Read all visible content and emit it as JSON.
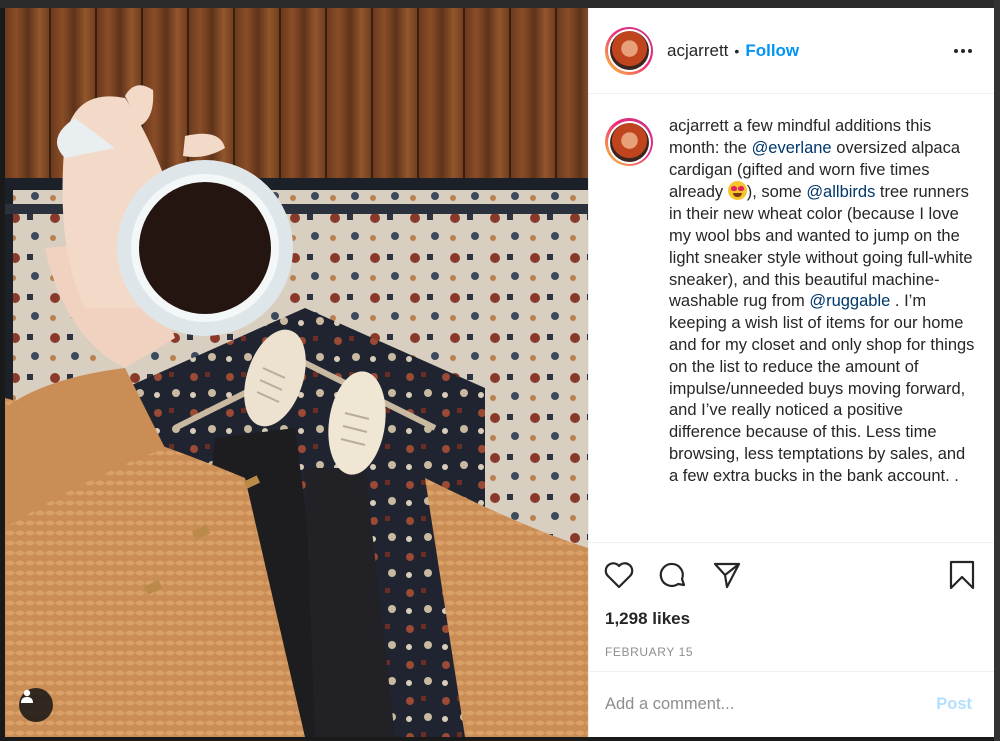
{
  "post": {
    "username": "acjarrett",
    "separator": "•",
    "follow_label": "Follow",
    "more_options_icon": "more-horizontal-icon",
    "caption": {
      "username": "acjarrett",
      "p1": " a few mindful additions this month: the ",
      "m1": "@everlane",
      "p2": " oversized alpaca cardigan (gifted and worn five times already ",
      "emoji": "heart-eyes-emoji",
      "p3": "), some ",
      "m2": "@allbirds",
      "p4": " tree runners in their new wheat color (because I love my wool bbs and wanted to jump on the light sneaker style without going full-white sneaker), and this beautiful machine-washable rug from ",
      "m3": "@ruggable",
      "p5": " . I’m keeping a wish list of items for our home and for my closet and only shop for things on the list to reduce the amount of impulse/unneeded buys moving forward, and I’ve really noticed a positive difference because of this. Less time browsing, less temptations by sales, and a few extra bucks in the bank account. ."
    },
    "actions": {
      "like_icon": "heart-icon",
      "comment_icon": "comment-icon",
      "share_icon": "paper-plane-icon",
      "save_icon": "bookmark-icon"
    },
    "likes": "1,298 likes",
    "date": "FEBRUARY 15",
    "comment": {
      "placeholder": "Add a comment...",
      "post_label": "Post"
    },
    "photo": {
      "user_tag_icon": "user-icon"
    }
  },
  "colors": {
    "accent": "#0095f6",
    "mention": "#00376b",
    "post_disabled": "#b2dffc",
    "text": "#262626",
    "muted": "#8e8e8e"
  }
}
